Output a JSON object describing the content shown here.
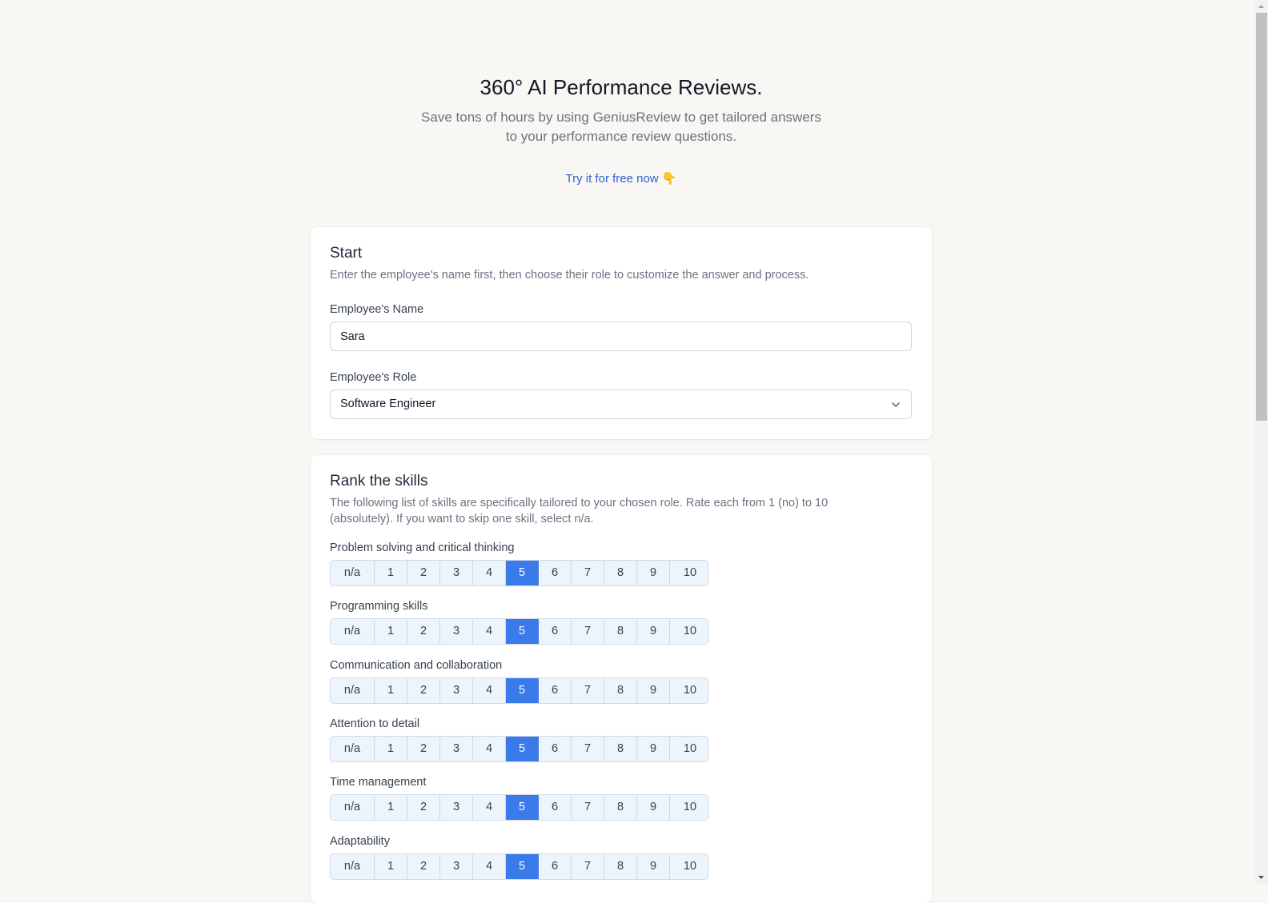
{
  "hero": {
    "title": "360° AI Performance Reviews.",
    "subtitle_line1": "Save tons of hours by using GeniusReview to get tailored answers",
    "subtitle_line2": "to your performance review questions.",
    "cta_label": "Try it for free now 👇"
  },
  "start": {
    "title": "Start",
    "description": "Enter the employee's name first, then choose their role to customize the answer and process.",
    "name_label": "Employee's Name",
    "name_value": "Sara",
    "role_label": "Employee's Role",
    "role_value": "Software Engineer",
    "role_icon": "chevron-down-icon"
  },
  "skills": {
    "title": "Rank the skills",
    "description": "The following list of skills are specifically tailored to your chosen role. Rate each from 1 (no) to 10 (absolutely). If you want to skip one skill, select n/a.",
    "options": [
      "n/a",
      "1",
      "2",
      "3",
      "4",
      "5",
      "6",
      "7",
      "8",
      "9",
      "10"
    ],
    "accent_color": "#3b7ae9",
    "items": [
      {
        "label": "Problem solving and critical thinking",
        "selected": "5"
      },
      {
        "label": "Programming skills",
        "selected": "5"
      },
      {
        "label": "Communication and collaboration",
        "selected": "5"
      },
      {
        "label": "Attention to detail",
        "selected": "5"
      },
      {
        "label": "Time management",
        "selected": "5"
      },
      {
        "label": "Adaptability",
        "selected": "5"
      }
    ]
  }
}
